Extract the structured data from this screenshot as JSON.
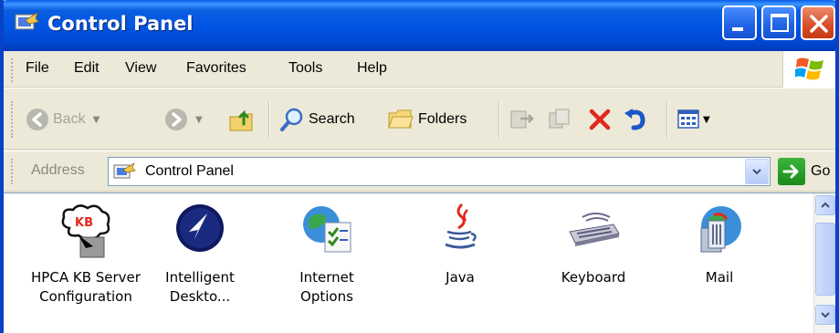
{
  "window": {
    "title": "Control Panel"
  },
  "menu": {
    "items": [
      {
        "label": "File"
      },
      {
        "label": "Edit"
      },
      {
        "label": "View"
      },
      {
        "label": "Favorites"
      },
      {
        "label": "Tools"
      },
      {
        "label": "Help"
      }
    ]
  },
  "toolbar": {
    "back_label": "Back",
    "search_label": "Search",
    "folders_label": "Folders"
  },
  "address": {
    "label": "Address",
    "value": "Control Panel",
    "go_label": "Go"
  },
  "items": [
    {
      "label": "HPCA KB Server Configuration",
      "icon": "hpca-kb-icon"
    },
    {
      "label": "Intelligent Deskto...",
      "icon": "intelligent-desktop-icon"
    },
    {
      "label": "Internet Options",
      "icon": "internet-options-icon"
    },
    {
      "label": "Java",
      "icon": "java-icon"
    },
    {
      "label": "Keyboard",
      "icon": "keyboard-icon"
    },
    {
      "label": "Mail",
      "icon": "mail-icon"
    }
  ],
  "colors": {
    "titlebar": "#0054e3",
    "close_button": "#d9512a",
    "window_bg": "#ece9d8",
    "content_bg": "#ffffff"
  }
}
